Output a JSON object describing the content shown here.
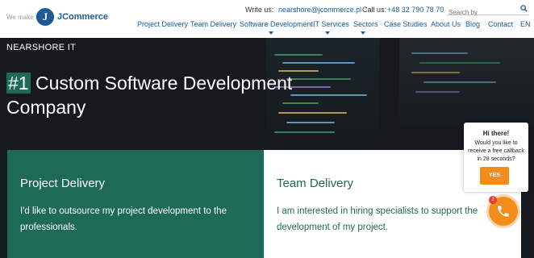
{
  "header": {
    "slogan": "We make IT",
    "logo_mark": "J",
    "logo_text": "JCommerce",
    "write_label": "Write us:",
    "email": "nearshore@jcommerce.pl",
    "call_label": "Call us:",
    "phone": "+48 32 790 78 70",
    "search_placeholder": "Search by"
  },
  "nav": {
    "items": [
      {
        "label": "Project Delivery"
      },
      {
        "label": "Team Delivery"
      },
      {
        "label": "Software Development"
      },
      {
        "label": "IT Services"
      },
      {
        "label": "Sectors"
      },
      {
        "label": "Case Studies"
      },
      {
        "label": "About Us"
      },
      {
        "label": "Blog"
      },
      {
        "label": "Contact"
      },
      {
        "label": "EN"
      }
    ]
  },
  "hero": {
    "eyebrow": "NEARSHORE IT",
    "headline_hl": "#1",
    "headline_rest": " Custom Software Development Company"
  },
  "cards": [
    {
      "title": "Project Delivery",
      "desc": "I'd like to outsource my project development to the professionals."
    },
    {
      "title": "Team Delivery",
      "desc": "I am interested in hiring specialists to support the development of my project."
    }
  ],
  "popup": {
    "title": "Hi there!",
    "text": "Would you like to receive a free callback in 28 seconds?",
    "button": "YES",
    "badge": "2"
  },
  "colors": {
    "brand_blue": "#1a5b96",
    "brand_green": "#1e6b55",
    "accent_orange": "#f28c1a"
  }
}
